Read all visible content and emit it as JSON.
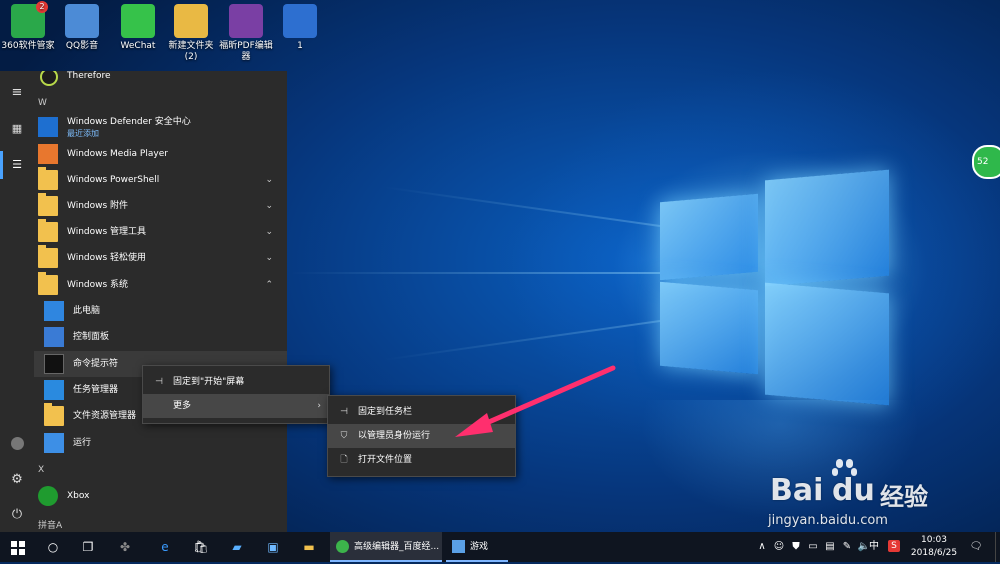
{
  "desktop": {
    "icons": [
      {
        "label": "360软件管家",
        "badge": "2",
        "color": "#2aa84a",
        "icon": "360-manager-icon"
      },
      {
        "label": "QQ影音",
        "color": "#4c8bd6",
        "icon": "qq-player-icon"
      },
      {
        "label": "WeChat",
        "color": "#36c24a",
        "icon": "wechat-icon"
      },
      {
        "label": "新建文件夹 (2)",
        "color": "#e9b944",
        "icon": "folder-icon"
      },
      {
        "label": "福昕PDF编辑器",
        "color": "#7a3fa4",
        "icon": "pdf-editor-icon"
      },
      {
        "label": "1",
        "color": "#2d6fd0",
        "icon": "app-icon"
      }
    ],
    "side_bubble": "52"
  },
  "start_menu": {
    "rail": {
      "hamburger": "≡",
      "tiles": "▦",
      "list": "☰",
      "user": "👤",
      "settings": "⚙",
      "power": "⏻"
    },
    "top_partial": "Therefore",
    "letters": {
      "w": "W",
      "x": "X",
      "pinyin": "拼音A"
    },
    "items": {
      "defender": {
        "label": "Windows Defender 安全中心",
        "sub": "最近添加"
      },
      "media_player": {
        "label": "Windows Media Player"
      },
      "powershell": {
        "label": "Windows PowerShell"
      },
      "accessories": {
        "label": "Windows 附件"
      },
      "admin_tools": {
        "label": "Windows 管理工具"
      },
      "ease_access": {
        "label": "Windows 轻松使用"
      },
      "system": {
        "label": "Windows 系统"
      },
      "this_pc": {
        "label": "此电脑"
      },
      "control_panel": {
        "label": "控制面板"
      },
      "cmd": {
        "label": "命令提示符"
      },
      "task_manager": {
        "label": "任务管理器"
      },
      "explorer": {
        "label": "文件资源管理器"
      },
      "run": {
        "label": "运行"
      },
      "xbox": {
        "label": "Xbox"
      }
    }
  },
  "context_menu": {
    "pin_start": "固定到\"开始\"屏幕",
    "more": "更多"
  },
  "submenu": {
    "pin_taskbar": "固定到任务栏",
    "run_admin": "以管理员身份运行",
    "open_location": "打开文件位置"
  },
  "watermark": {
    "logo": "Bai",
    "du": "du",
    "brand": "经验",
    "url": "jingyan.baidu.com"
  },
  "taskbar": {
    "apps": [
      {
        "label": "高级编辑器_百度经...",
        "icon": "browser-360-icon"
      },
      {
        "label": "游戏",
        "icon": "game-icon"
      }
    ],
    "tray": {
      "chevron": "∧",
      "ime": "中",
      "sogou": "S",
      "time": "10:03",
      "date": "2018/6/25",
      "notification": "🗨"
    }
  }
}
